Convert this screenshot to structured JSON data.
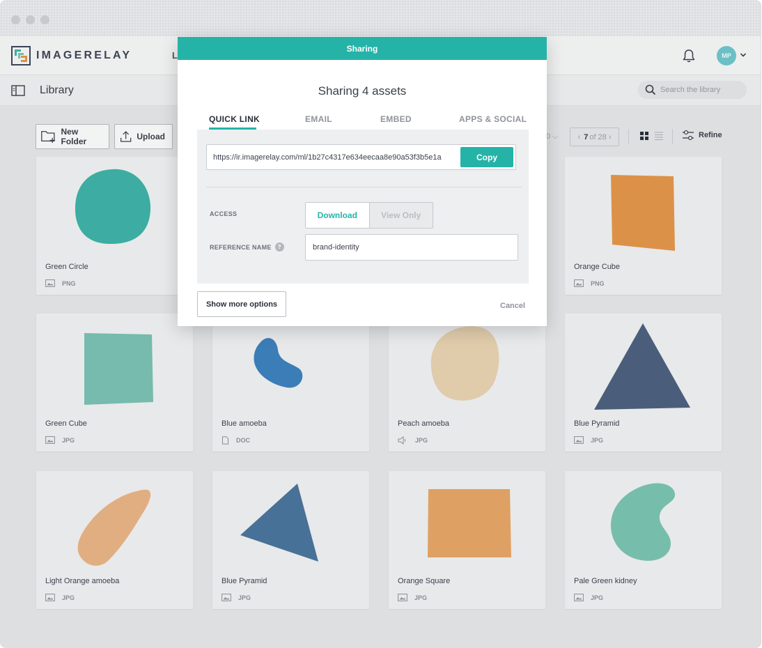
{
  "app": {
    "logo_text": "IMAGERELAY",
    "nav_partial_letter": "L",
    "user_initials": "MP",
    "icons": [
      "bell-icon",
      "chevron-down-icon",
      "library-panel-icon",
      "search-icon"
    ]
  },
  "subbar": {
    "title": "Library",
    "search_placeholder": "Search the library"
  },
  "toolbar": {
    "new_folder_label": "New Folder",
    "upload_label": "Upload",
    "hidden_fragment": "0",
    "pager_prefix": "‹",
    "pager_current": "7",
    "pager_of": "of 28",
    "pager_suffix": "›",
    "refine_label": "Refine"
  },
  "assets": [
    {
      "name": "Green Circle",
      "type": "PNG",
      "type_icon": "image-icon",
      "color": "#3fb5aa",
      "shape": "blob-circle"
    },
    {
      "name": "",
      "type": "",
      "type_icon": "",
      "color": "",
      "shape": "hidden"
    },
    {
      "name": "",
      "type": "",
      "type_icon": "",
      "color": "",
      "shape": "hidden"
    },
    {
      "name": "Orange Cube",
      "type": "PNG",
      "type_icon": "image-icon",
      "color": "#e8974a",
      "shape": "quad"
    },
    {
      "name": "Green Cube",
      "type": "JPG",
      "type_icon": "image-icon",
      "color": "#7cc4b5",
      "shape": "quad"
    },
    {
      "name": "Blue amoeba",
      "type": "DOC",
      "type_icon": "doc-icon",
      "color": "#3d82bf",
      "shape": "amoeba"
    },
    {
      "name": "Peach amoeba",
      "type": "JPG",
      "type_icon": "audio-icon",
      "color": "#ecd5b3",
      "shape": "peach-blob"
    },
    {
      "name": "Blue Pyramid",
      "type": "JPG",
      "type_icon": "image-icon",
      "color": "#4d6180",
      "shape": "triangle"
    },
    {
      "name": "Light Orange amoeba",
      "type": "JPG",
      "type_icon": "image-icon",
      "color": "#edb687",
      "shape": "leaf"
    },
    {
      "name": "Blue Pyramid",
      "type": "JPG",
      "type_icon": "image-icon",
      "color": "#4b759e",
      "shape": "triangle-tilt"
    },
    {
      "name": "Orange Square",
      "type": "JPG",
      "type_icon": "image-icon",
      "color": "#eaa866",
      "shape": "square"
    },
    {
      "name": "Pale Green kidney",
      "type": "JPG",
      "type_icon": "image-icon",
      "color": "#7dc6b3",
      "shape": "kidney"
    }
  ],
  "modal": {
    "header": "Sharing",
    "title": "Sharing 4 assets",
    "tabs": [
      "QUICK LINK",
      "EMAIL",
      "EMBED",
      "APPS & SOCIAL"
    ],
    "active_tab": "QUICK LINK",
    "link_url": "https://ir.imagerelay.com/ml/1b27c4317e634eecaa8e90a53f3b5e1a",
    "copy_label": "Copy",
    "access_label": "ACCESS",
    "access_options": [
      "Download",
      "View Only"
    ],
    "access_selected": "Download",
    "reference_label": "REFERENCE NAME",
    "help_symbol": "?",
    "reference_value": "brand-identity",
    "more_options_label": "Show more options",
    "cancel_label": "Cancel",
    "accent_color": "#25b3a8"
  }
}
